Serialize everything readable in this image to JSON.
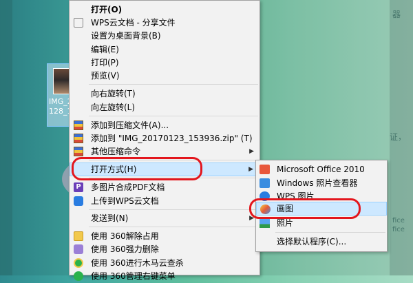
{
  "desktop": {
    "file_name_line1": "IMG_2",
    "file_name_line2": "128_1"
  },
  "context_menu": {
    "items": [
      {
        "label": "打开(O)"
      },
      {
        "label": "WPS云文档 - 分享文件"
      },
      {
        "label": "设置为桌面背景(B)"
      },
      {
        "label": "编辑(E)"
      },
      {
        "label": "打印(P)"
      },
      {
        "label": "预览(V)"
      },
      {
        "label": "向右旋转(T)"
      },
      {
        "label": "向左旋转(L)"
      },
      {
        "label": "添加到压缩文件(A)..."
      },
      {
        "label": "添加到 \"IMG_20170123_153936.zip\" (T)"
      },
      {
        "label": "其他压缩命令"
      },
      {
        "label": "打开方式(H)"
      },
      {
        "label": "多图片合成PDF文档"
      },
      {
        "label": "上传到WPS云文档"
      },
      {
        "label": "发送到(N)"
      },
      {
        "label": "使用 360解除占用"
      },
      {
        "label": "使用 360强力删除"
      },
      {
        "label": "使用 360进行木马云查杀"
      },
      {
        "label": "使用 360管理右键菜单"
      }
    ],
    "pdf_icon_text": "P"
  },
  "open_with_submenu": {
    "items": [
      {
        "label": "Microsoft Office 2010"
      },
      {
        "label": "Windows 照片查看器"
      },
      {
        "label": "WPS 图片"
      },
      {
        "label": "画图"
      },
      {
        "label": "照片"
      },
      {
        "label": "选择默认程序(C)..."
      }
    ]
  },
  "background_hints": {
    "top": "器",
    "mid": "证，",
    "low1": "fice",
    "low2": "fice"
  },
  "colors": {
    "highlight": "#cde8ff",
    "annotation_red": "#e3161d"
  }
}
